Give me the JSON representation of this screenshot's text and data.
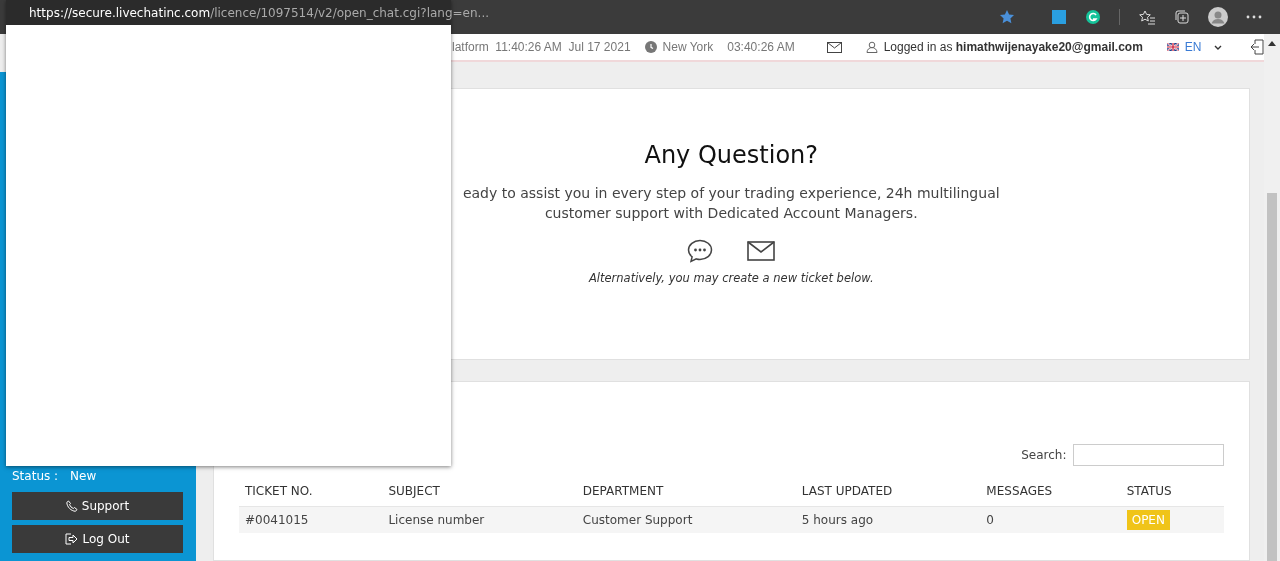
{
  "popup": {
    "url_host": "https://secure.livechatinc.com",
    "url_path": "/licence/1097514/v2/open_chat.cgi?lang=en..."
  },
  "header": {
    "platform_time": "latform  11:40:26 AM  Jul 17 2021",
    "city": "New York",
    "city_time": "03:40:26 AM",
    "login": "Logged in as **himathwijenayake20@gmail.com**",
    "language": "EN"
  },
  "sidebar": {
    "status_label": "Status :",
    "status_value": "New",
    "buttons": [
      {
        "label": "Support",
        "kind": "phone"
      },
      {
        "label": "Log Out",
        "kind": "logout"
      }
    ]
  },
  "contact": {
    "title": "Any Question?",
    "text": "eady to assist you in every step of your trading experience, 24h multilingual customer support with Dedicated Account Managers.",
    "note": "Alternatively, you may create a new ticket below."
  },
  "tickets": {
    "search_label": "Search:",
    "columns": [
      "TICKET NO.",
      "SUBJECT",
      "DEPARTMENT",
      "LAST UPDATED",
      "MESSAGES",
      "STATUS"
    ],
    "rows": [
      {
        "cells": [
          "#0041015",
          "License number",
          "Customer Support",
          "5 hours ago",
          "0"
        ],
        "status": "OPEN",
        "color": "#f0c419"
      }
    ]
  }
}
